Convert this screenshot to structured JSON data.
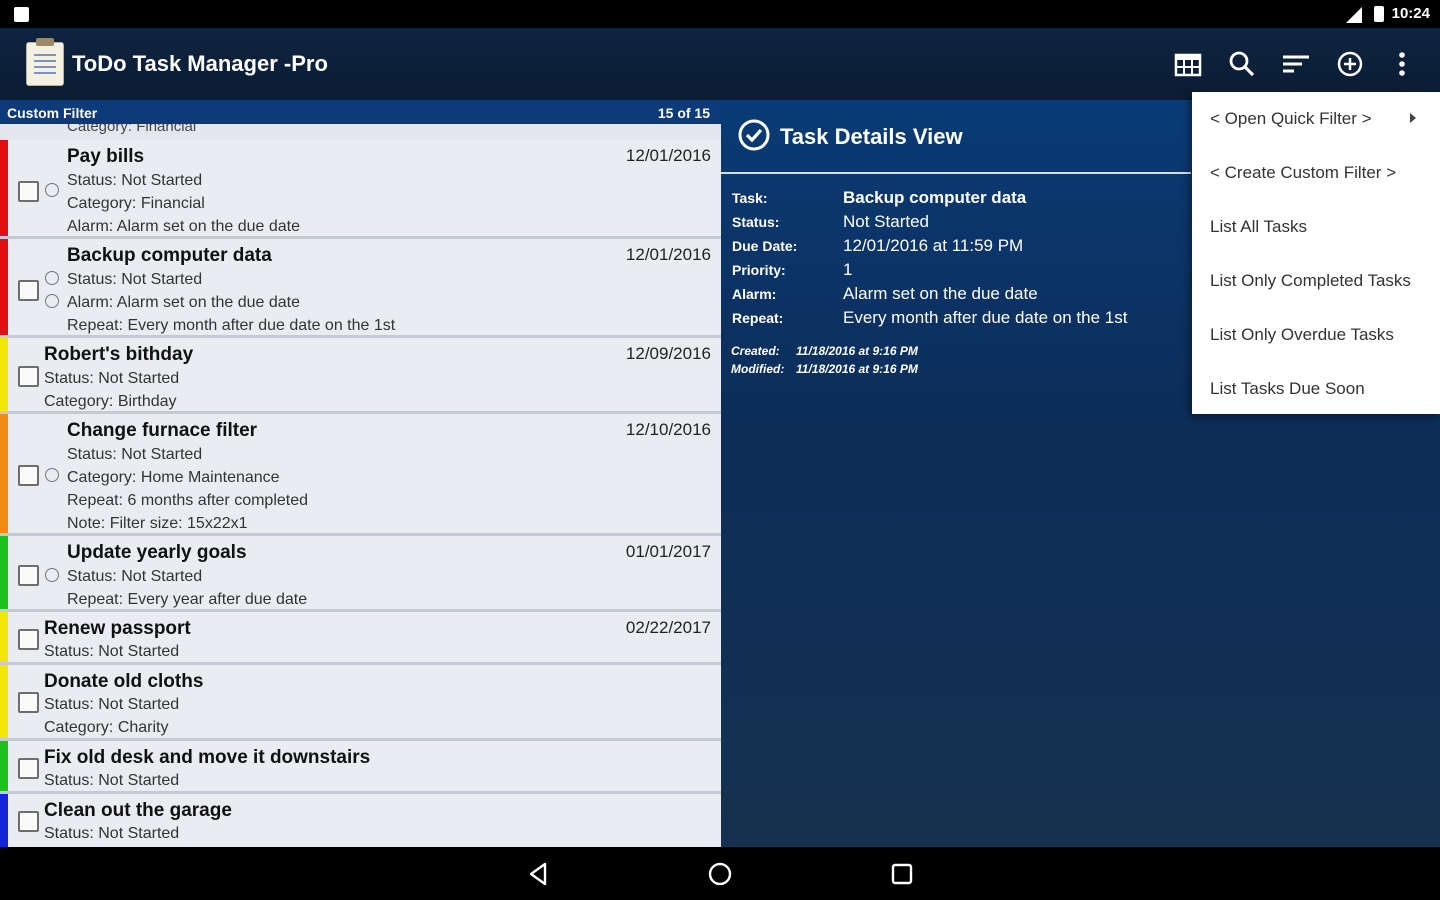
{
  "status_bar": {
    "time": "10:24"
  },
  "app_bar": {
    "title": "ToDo Task Manager -Pro",
    "actions": [
      "calendar-icon",
      "search-icon",
      "sort-icon",
      "add-icon",
      "more-vert-icon"
    ]
  },
  "list": {
    "header_label": "Custom Filter",
    "count": "15 of 15",
    "peek_text": "Category: Financial",
    "tasks": [
      {
        "title": "Pay bills",
        "date": "12/01/2016",
        "color": "#e01010",
        "lines": [
          "Status: Not Started",
          "Category: Financial",
          "Alarm: Alarm set on the due date"
        ]
      },
      {
        "title": "Backup computer data",
        "date": "12/01/2016",
        "color": "#e01010",
        "lines": [
          "Status: Not Started",
          "Alarm: Alarm set on the due date",
          "Repeat: Every month after due date on the 1st"
        ]
      },
      {
        "title": "Robert's bithday",
        "date": "12/09/2016",
        "color": "#f5e60a",
        "lines": [
          "Status: Not Started",
          "Category: Birthday"
        ]
      },
      {
        "title": "Change furnace filter",
        "date": "12/10/2016",
        "color": "#f08a12",
        "lines": [
          "Status: Not Started",
          "Category: Home Maintenance",
          "Repeat: 6 months after completed",
          "Note: Filter size: 15x22x1"
        ]
      },
      {
        "title": "Update yearly goals",
        "date": "01/01/2017",
        "color": "#1cc21c",
        "lines": [
          "Status: Not Started",
          "Repeat: Every year after due date"
        ]
      },
      {
        "title": "Renew passport",
        "date": "02/22/2017",
        "color": "#f5e60a",
        "lines": [
          "Status: Not Started"
        ]
      },
      {
        "title": "Donate old cloths",
        "date": "",
        "color": "#f5e60a",
        "lines": [
          "Status: Not Started",
          "Category: Charity"
        ]
      },
      {
        "title": "Fix old desk and move it downstairs",
        "date": "",
        "color": "#1cc21c",
        "lines": [
          "Status: Not Started"
        ]
      },
      {
        "title": "Clean out the garage",
        "date": "",
        "color": "#1224d8",
        "lines": [
          "Status: Not Started"
        ]
      }
    ]
  },
  "detail": {
    "title": "Task Details View",
    "fields": [
      {
        "key": "Task:",
        "value": "Backup computer data"
      },
      {
        "key": "Status:",
        "value": "Not Started"
      },
      {
        "key": "Due Date:",
        "value": "12/01/2016 at 11:59 PM"
      },
      {
        "key": "Priority:",
        "value": "1"
      },
      {
        "key": "Alarm:",
        "value": "Alarm set on the due date"
      },
      {
        "key": "Repeat:",
        "value": "Every month after due date on the 1st"
      }
    ],
    "created_label": "Created:",
    "created_value": "11/18/2016 at 9:16 PM",
    "modified_label": "Modified:",
    "modified_value": "11/18/2016 at 9:16 PM"
  },
  "menu": {
    "items": [
      "< Open Quick Filter >",
      "< Create Custom Filter >",
      "List All Tasks",
      "List Only Completed Tasks",
      "List Only Overdue Tasks",
      "List Tasks Due Soon"
    ]
  },
  "nav": [
    "back-icon",
    "home-icon",
    "recents-icon"
  ]
}
